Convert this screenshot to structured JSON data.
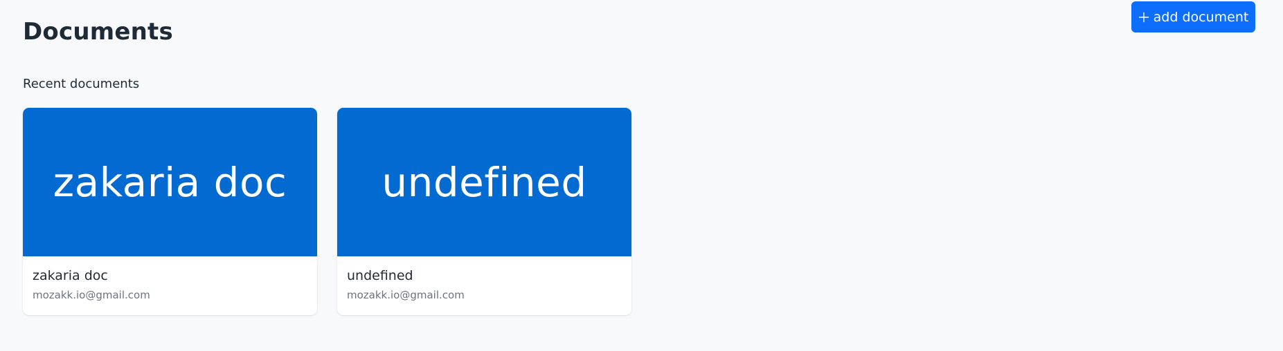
{
  "header": {
    "title": "Documents",
    "add_button_label": "add document"
  },
  "section": {
    "title": "Recent documents"
  },
  "documents": [
    {
      "thumbnail_text": "zakaria doc",
      "title": "zakaria doc",
      "owner": "mozakk.io@gmail.com"
    },
    {
      "thumbnail_text": "undefined",
      "title": "undefined",
      "owner": "mozakk.io@gmail.com"
    }
  ],
  "colors": {
    "accent": "#0d6efd",
    "thumbnail": "#036ad1"
  },
  "icons": {
    "add": "plus-icon"
  }
}
